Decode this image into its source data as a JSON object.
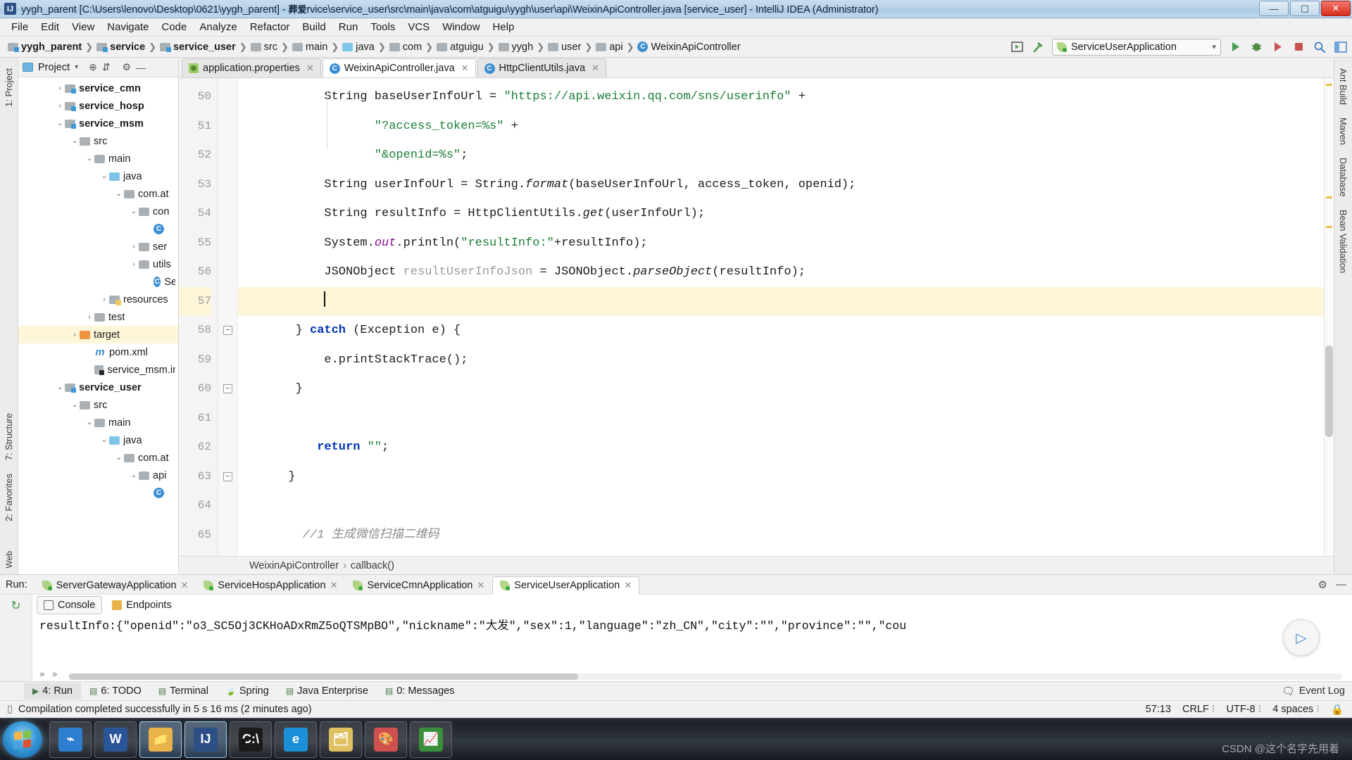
{
  "window": {
    "title_prefix": "yygh_parent [C:\\Users\\lenovo\\Desktop\\0621\\yygh_parent] - ",
    "title_cjk": "葬爱",
    "title_suffix": "rvice\\service_user\\src\\main\\java\\com\\atguigu\\yygh\\user\\api\\WeixinApiController.java [service_user] - IntelliJ IDEA (Administrator)",
    "app_icon": "idea-icon",
    "minimize": "—",
    "maximize": "▢",
    "close": "✕"
  },
  "menu": [
    "File",
    "Edit",
    "View",
    "Navigate",
    "Code",
    "Analyze",
    "Refactor",
    "Build",
    "Run",
    "Tools",
    "VCS",
    "Window",
    "Help"
  ],
  "breadcrumb": [
    {
      "label": "yygh_parent",
      "icon": "module-folder-icon",
      "bold": true
    },
    {
      "label": "service",
      "icon": "module-folder-icon",
      "bold": true
    },
    {
      "label": "service_user",
      "icon": "module-folder-icon",
      "bold": true
    },
    {
      "label": "src",
      "icon": "folder-icon",
      "bold": false
    },
    {
      "label": "main",
      "icon": "folder-icon",
      "bold": false
    },
    {
      "label": "java",
      "icon": "source-folder-icon",
      "bold": false
    },
    {
      "label": "com",
      "icon": "package-icon",
      "bold": false
    },
    {
      "label": "atguigu",
      "icon": "package-icon",
      "bold": false
    },
    {
      "label": "yygh",
      "icon": "package-icon",
      "bold": false
    },
    {
      "label": "user",
      "icon": "package-icon",
      "bold": false
    },
    {
      "label": "api",
      "icon": "package-icon",
      "bold": false
    },
    {
      "label": "WeixinApiController",
      "icon": "class-icon",
      "bold": false
    }
  ],
  "toolbar": {
    "run_config_name": "ServiceUserApplication",
    "run_config_icon": "spring-leaf-icon",
    "dropdown_caret": "▾",
    "icons": [
      {
        "name": "run-anything-icon",
        "glyph": "▣"
      },
      {
        "name": "build-hammer-icon",
        "glyph": "🔨"
      },
      {
        "name": "run-icon",
        "glyph": "▶"
      },
      {
        "name": "debug-icon",
        "glyph": "🐞"
      },
      {
        "name": "run-with-coverage-icon",
        "glyph": "▶"
      },
      {
        "name": "stop-icon",
        "glyph": "■"
      },
      {
        "name": "search-everywhere-icon",
        "glyph": "🔍"
      },
      {
        "name": "layout-icon",
        "glyph": "▦"
      }
    ]
  },
  "project_pane": {
    "title": "Project",
    "caret": "▾",
    "header_icons": [
      {
        "name": "locate-target-icon",
        "glyph": "⊕"
      },
      {
        "name": "collapse-all-icon",
        "glyph": "⇵"
      },
      {
        "name": "settings-gear-icon",
        "glyph": "⚙"
      },
      {
        "name": "hide-icon",
        "glyph": "—"
      }
    ],
    "tree": [
      {
        "label": "service_cmn",
        "indent": 2,
        "arrow": "›",
        "icon": "module-folder-icon",
        "bold": true,
        "selected": false
      },
      {
        "label": "service_hosp",
        "indent": 2,
        "arrow": "›",
        "icon": "module-folder-icon",
        "bold": true,
        "selected": false
      },
      {
        "label": "service_msm",
        "indent": 2,
        "arrow": "⌄",
        "icon": "module-folder-icon",
        "bold": true,
        "selected": false
      },
      {
        "label": "src",
        "indent": 3,
        "arrow": "⌄",
        "icon": "folder-icon",
        "bold": false,
        "selected": false
      },
      {
        "label": "main",
        "indent": 4,
        "arrow": "⌄",
        "icon": "folder-icon",
        "bold": false,
        "selected": false
      },
      {
        "label": "java",
        "indent": 5,
        "arrow": "⌄",
        "icon": "source-folder-icon",
        "bold": false,
        "selected": false
      },
      {
        "label": "com.at",
        "indent": 6,
        "arrow": "⌄",
        "icon": "package-icon",
        "bold": false,
        "selected": false
      },
      {
        "label": "con",
        "indent": 7,
        "arrow": "⌄",
        "icon": "package-icon",
        "bold": false,
        "selected": false
      },
      {
        "label": "",
        "indent": 8,
        "arrow": "",
        "icon": "class-icon",
        "bold": false,
        "selected": false
      },
      {
        "label": "ser",
        "indent": 7,
        "arrow": "›",
        "icon": "package-icon",
        "bold": false,
        "selected": false
      },
      {
        "label": "utils",
        "indent": 7,
        "arrow": "›",
        "icon": "package-icon",
        "bold": false,
        "selected": false
      },
      {
        "label": "Ser",
        "indent": 8,
        "arrow": "",
        "icon": "class-icon",
        "bold": false,
        "selected": false
      },
      {
        "label": "resources",
        "indent": 5,
        "arrow": "›",
        "icon": "resources-folder-icon",
        "bold": false,
        "selected": false
      },
      {
        "label": "test",
        "indent": 4,
        "arrow": "›",
        "icon": "folder-icon",
        "bold": false,
        "selected": false
      },
      {
        "label": "target",
        "indent": 3,
        "arrow": "›",
        "icon": "target-folder-icon",
        "bold": false,
        "selected": true
      },
      {
        "label": "pom.xml",
        "indent": 4,
        "arrow": "",
        "icon": "maven-icon",
        "bold": false,
        "selected": false
      },
      {
        "label": "service_msm.iml",
        "indent": 4,
        "arrow": "",
        "icon": "iml-icon",
        "bold": false,
        "selected": false
      },
      {
        "label": "service_user",
        "indent": 2,
        "arrow": "⌄",
        "icon": "module-folder-icon",
        "bold": true,
        "selected": false
      },
      {
        "label": "src",
        "indent": 3,
        "arrow": "⌄",
        "icon": "folder-icon",
        "bold": false,
        "selected": false
      },
      {
        "label": "main",
        "indent": 4,
        "arrow": "⌄",
        "icon": "folder-icon",
        "bold": false,
        "selected": false
      },
      {
        "label": "java",
        "indent": 5,
        "arrow": "⌄",
        "icon": "source-folder-icon",
        "bold": false,
        "selected": false
      },
      {
        "label": "com.at",
        "indent": 6,
        "arrow": "⌄",
        "icon": "package-icon",
        "bold": false,
        "selected": false
      },
      {
        "label": "api",
        "indent": 7,
        "arrow": "⌄",
        "icon": "package-icon",
        "bold": false,
        "selected": false
      },
      {
        "label": "",
        "indent": 8,
        "arrow": "",
        "icon": "class-icon",
        "bold": false,
        "selected": false
      }
    ]
  },
  "left_strip": [
    "1: Project",
    "7: Structure",
    "2: Favorites"
  ],
  "right_strip": [
    "Ant Build",
    "Maven",
    "Database",
    "Bean Validation"
  ],
  "editor": {
    "tabs": [
      {
        "label": "application.properties",
        "icon": "properties-file-icon",
        "active": false,
        "close": "✕"
      },
      {
        "label": "WeixinApiController.java",
        "icon": "java-class-icon",
        "active": true,
        "close": "✕"
      },
      {
        "label": "HttpClientUtils.java",
        "icon": "java-class-icon",
        "active": false,
        "close": "✕"
      }
    ],
    "first_line_number": 50,
    "lines": [
      {
        "n": 50,
        "indent": 12,
        "highlight": false,
        "fold": "",
        "tokens": [
          {
            "t": "String baseUserInfoUrl = ",
            "c": "plain"
          },
          {
            "t": "\"https://api.weixin.qq.com/sns/userinfo\"",
            "c": "str"
          },
          {
            "t": " +",
            "c": "plain"
          }
        ]
      },
      {
        "n": 51,
        "indent": 19,
        "highlight": false,
        "fold": "",
        "tokens": [
          {
            "t": "\"?access_token=%s\"",
            "c": "str"
          },
          {
            "t": " +",
            "c": "plain"
          }
        ]
      },
      {
        "n": 52,
        "indent": 19,
        "highlight": false,
        "fold": "",
        "tokens": [
          {
            "t": "\"&openid=%s\"",
            "c": "str"
          },
          {
            "t": ";",
            "c": "plain"
          }
        ]
      },
      {
        "n": 53,
        "indent": 12,
        "highlight": false,
        "fold": "",
        "tokens": [
          {
            "t": "String userInfoUrl = String.",
            "c": "plain"
          },
          {
            "t": "format",
            "c": "mth"
          },
          {
            "t": "(baseUserInfoUrl, access_token, openid);",
            "c": "plain"
          }
        ]
      },
      {
        "n": 54,
        "indent": 12,
        "highlight": false,
        "fold": "",
        "tokens": [
          {
            "t": "String resultInfo = HttpClientUtils.",
            "c": "plain"
          },
          {
            "t": "get",
            "c": "mth"
          },
          {
            "t": "(userInfoUrl);",
            "c": "plain"
          }
        ]
      },
      {
        "n": 55,
        "indent": 12,
        "highlight": false,
        "fold": "",
        "tokens": [
          {
            "t": "System.",
            "c": "plain"
          },
          {
            "t": "out",
            "c": "fld"
          },
          {
            "t": ".println(",
            "c": "plain"
          },
          {
            "t": "\"resultInfo:\"",
            "c": "str"
          },
          {
            "t": "+resultInfo);",
            "c": "plain"
          }
        ]
      },
      {
        "n": 56,
        "indent": 12,
        "highlight": false,
        "fold": "",
        "tokens": [
          {
            "t": "JSONObject ",
            "c": "plain"
          },
          {
            "t": "resultUserInfoJson",
            "c": "loc"
          },
          {
            "t": " = JSONObject.",
            "c": "plain"
          },
          {
            "t": "parseObject",
            "c": "mth"
          },
          {
            "t": "(resultInfo);",
            "c": "plain"
          }
        ]
      },
      {
        "n": 57,
        "indent": 12,
        "highlight": true,
        "fold": "",
        "caret": true,
        "tokens": []
      },
      {
        "n": 58,
        "indent": 8,
        "highlight": false,
        "fold": "−",
        "tokens": [
          {
            "t": "} ",
            "c": "plain"
          },
          {
            "t": "catch",
            "c": "kw"
          },
          {
            "t": " (Exception e) {",
            "c": "plain"
          }
        ]
      },
      {
        "n": 59,
        "indent": 12,
        "highlight": false,
        "fold": "",
        "tokens": [
          {
            "t": "e.printStackTrace();",
            "c": "plain"
          }
        ]
      },
      {
        "n": 60,
        "indent": 8,
        "highlight": false,
        "fold": "−",
        "tokens": [
          {
            "t": "}",
            "c": "plain"
          }
        ]
      },
      {
        "n": 61,
        "indent": 8,
        "highlight": false,
        "fold": "",
        "tokens": []
      },
      {
        "n": 62,
        "indent": 11,
        "highlight": false,
        "fold": "",
        "tokens": [
          {
            "t": "return",
            "c": "kw"
          },
          {
            "t": " ",
            "c": "plain"
          },
          {
            "t": "\"\"",
            "c": "str"
          },
          {
            "t": ";",
            "c": "plain"
          }
        ]
      },
      {
        "n": 63,
        "indent": 7,
        "highlight": false,
        "fold": "−",
        "tokens": [
          {
            "t": "}",
            "c": "plain"
          }
        ]
      },
      {
        "n": 64,
        "indent": 7,
        "highlight": false,
        "fold": "",
        "tokens": []
      },
      {
        "n": 65,
        "indent": 9,
        "highlight": false,
        "fold": "",
        "tokens": [
          {
            "t": "//1 生成微信扫描二维码",
            "c": "cmt"
          }
        ]
      }
    ],
    "bottom_breadcrumb": [
      "WeixinApiController",
      "callback()"
    ],
    "breadcrumb_sep": "›"
  },
  "run_panel": {
    "label": "Run:",
    "tabs": [
      {
        "label": "ServerGatewayApplication",
        "icon": "spring-leaf-icon",
        "active": false,
        "close": "✕"
      },
      {
        "label": "ServiceHospApplication",
        "icon": "spring-leaf-icon",
        "active": false,
        "close": "✕"
      },
      {
        "label": "ServiceCmnApplication",
        "icon": "spring-leaf-icon",
        "active": false,
        "close": "✕"
      },
      {
        "label": "ServiceUserApplication",
        "icon": "spring-leaf-icon",
        "active": true,
        "close": "✕"
      }
    ],
    "header_icons": [
      {
        "name": "settings-gear-icon",
        "glyph": "⚙"
      },
      {
        "name": "hide-panel-icon",
        "glyph": "—"
      }
    ],
    "side_icons": [
      {
        "name": "rerun-icon",
        "glyph": "↻"
      },
      {
        "name": "stop-icon",
        "glyph": "■"
      }
    ],
    "subtabs": [
      {
        "label": "Console",
        "icon": "console-icon",
        "active": true
      },
      {
        "label": "Endpoints",
        "icon": "endpoints-icon",
        "active": false
      }
    ],
    "console_line": "resultInfo:{\"openid\":\"o3_SC5Oj3CKHoADxRmZ5oQTSMpBO\",\"nickname\":\"大发\",\"sex\":1,\"language\":\"zh_CN\",\"city\":\"\",\"province\":\"\",\"cou"
  },
  "bottom_tabs": [
    {
      "label": "4: Run",
      "icon": "run-icon",
      "active": true
    },
    {
      "label": "6: TODO",
      "icon": "todo-icon",
      "active": false
    },
    {
      "label": "Terminal",
      "icon": "terminal-icon",
      "active": false
    },
    {
      "label": "Spring",
      "icon": "spring-leaf-icon",
      "active": false
    },
    {
      "label": "Java Enterprise",
      "icon": "java-enterprise-icon",
      "active": false
    },
    {
      "label": "0: Messages",
      "icon": "messages-icon",
      "active": false
    }
  ],
  "event_log": {
    "label": "Event Log",
    "icon": "event-log-icon"
  },
  "status_bar": {
    "message": "Compilation completed successfully in 5 s 16 ms (2 minutes ago)",
    "message_icon": "build-status-icon",
    "caret_position": "57:13",
    "line_separator": "CRLF",
    "encoding": "UTF-8",
    "indent": "4 spaces",
    "separator_caret": "⁝"
  },
  "taskbar": {
    "start_icon": "windows-start-icon",
    "apps": [
      {
        "name": "vscode-taskbar-icon",
        "glyph": "⌁",
        "color": "#2f7fd0",
        "active": false
      },
      {
        "name": "word-taskbar-icon",
        "glyph": "W",
        "color": "#2a5699",
        "active": false
      },
      {
        "name": "explorer-taskbar-icon",
        "glyph": "📁",
        "color": "#e8b44a",
        "active": true
      },
      {
        "name": "intellij-taskbar-icon",
        "glyph": "IJ",
        "color": "#2c4f86",
        "active": true
      },
      {
        "name": "cmd-taskbar-icon",
        "glyph": "C:\\",
        "color": "#1b1b1b",
        "active": false
      },
      {
        "name": "ie-taskbar-icon",
        "glyph": "e",
        "color": "#1b90d8",
        "active": false
      },
      {
        "name": "filemanager-taskbar-icon",
        "glyph": "🗂",
        "color": "#e0c060",
        "active": false
      },
      {
        "name": "paint-taskbar-icon",
        "glyph": "🎨",
        "color": "#d05050",
        "active": false
      },
      {
        "name": "chart-taskbar-icon",
        "glyph": "📈",
        "color": "#3a8f3a",
        "active": false
      }
    ],
    "watermark": "CSDN @这个名字先用着"
  }
}
